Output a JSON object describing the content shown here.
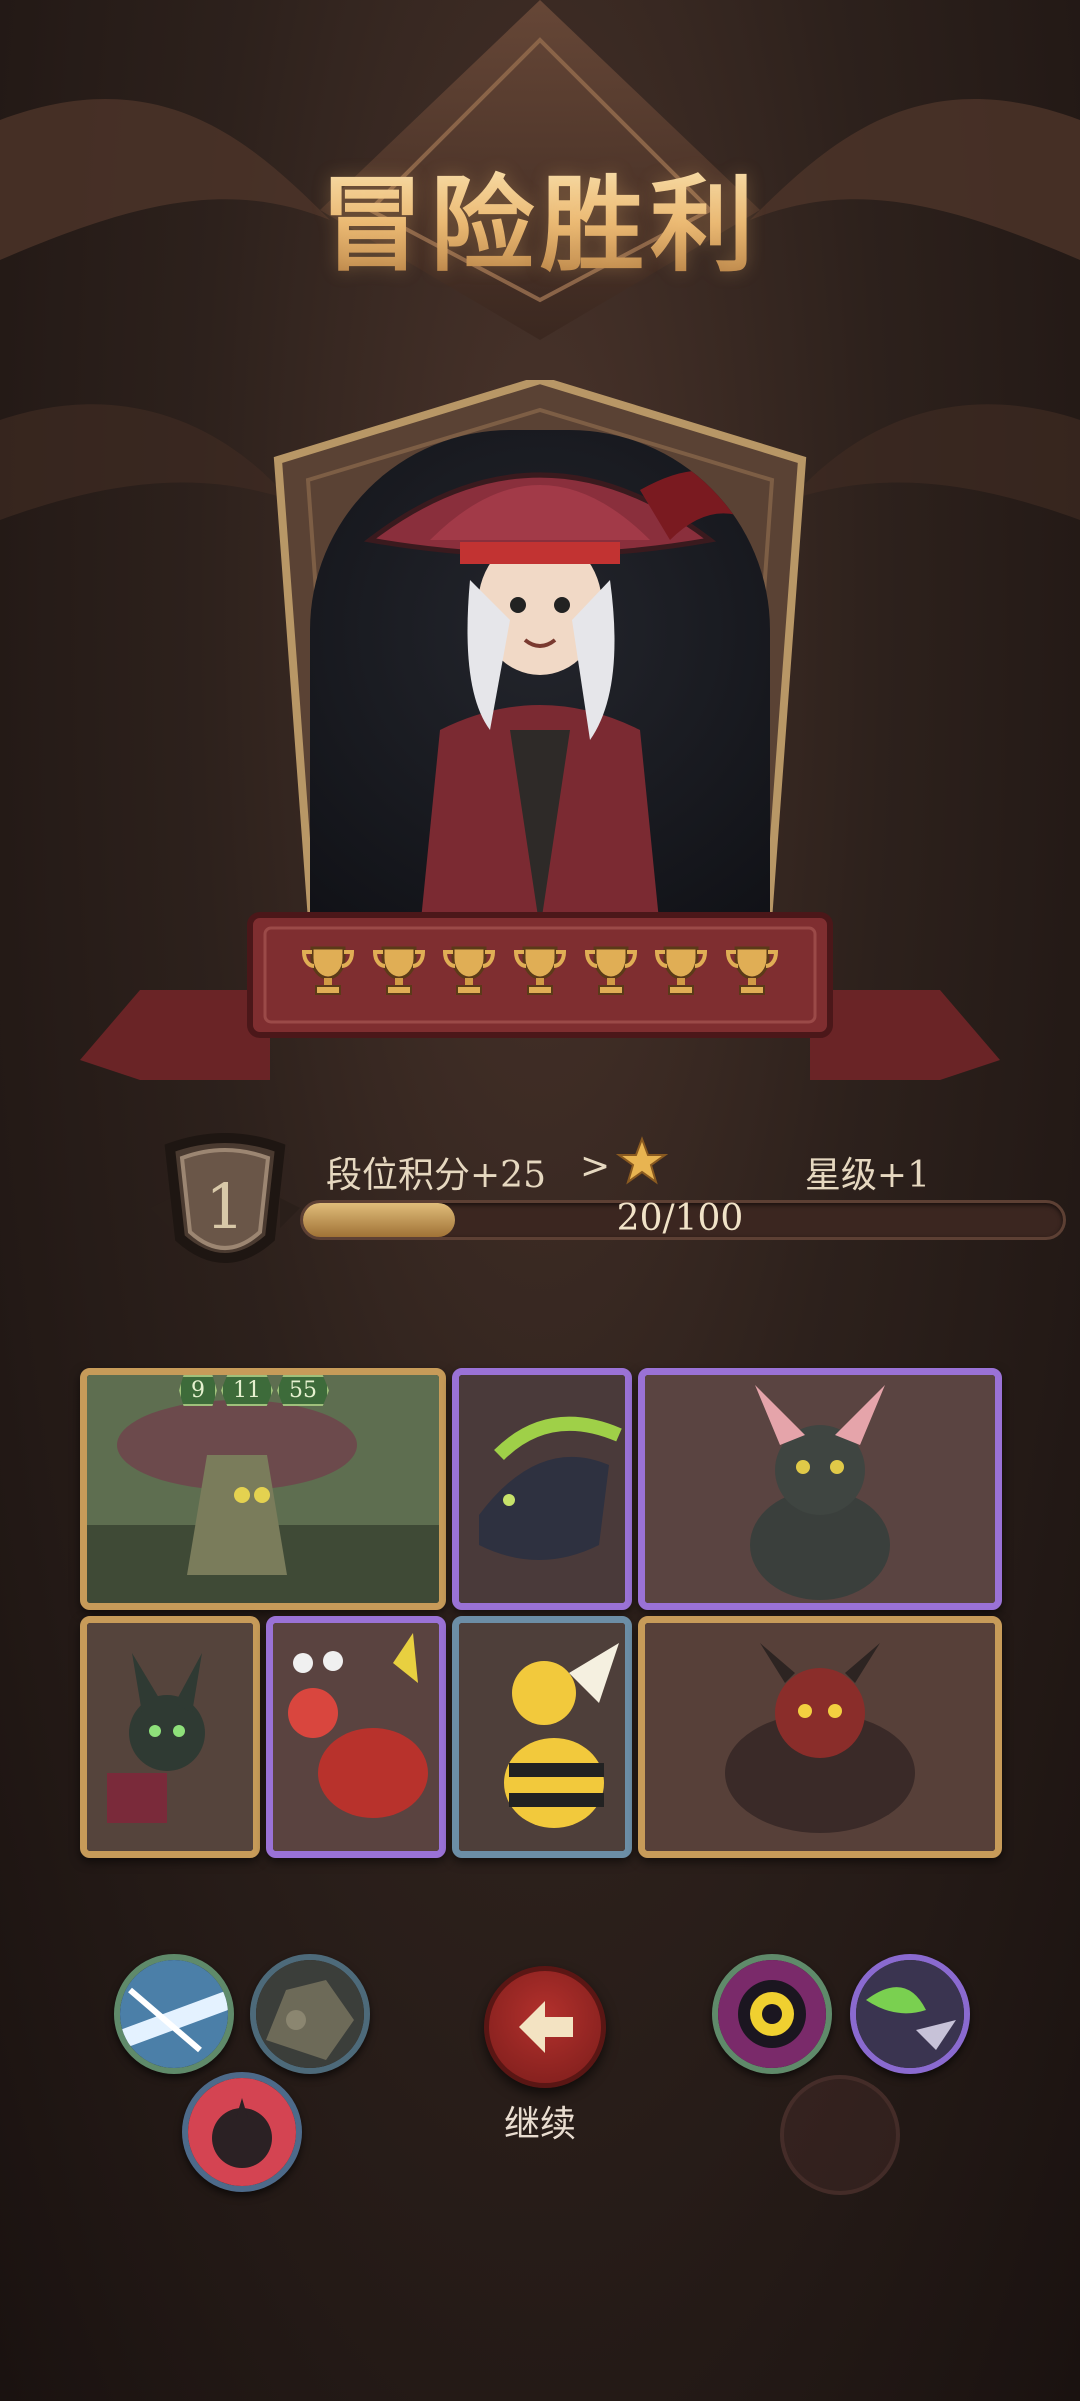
{
  "result": {
    "title": "冒险胜利"
  },
  "trophies": {
    "count": 7,
    "icon": "trophy-icon"
  },
  "rank": {
    "level": "1",
    "points_label": "段位积分+25",
    "arrow": ">",
    "star_icon": "star-icon",
    "star_label": "星级+1",
    "progress_text": "20/100",
    "progress_value": 20,
    "progress_max": 100
  },
  "cards": [
    {
      "name": "mushroom-treant",
      "rarity": "gold",
      "badges": [
        "9",
        "11",
        "55"
      ]
    },
    {
      "name": "shadow-wolf",
      "rarity": "purple"
    },
    {
      "name": "sphinx-cat",
      "rarity": "purple"
    },
    {
      "name": "cat-mage",
      "rarity": "gold"
    },
    {
      "name": "crab-beetle",
      "rarity": "purple"
    },
    {
      "name": "bee",
      "rarity": "blue"
    },
    {
      "name": "demon-beast",
      "rarity": "gold"
    }
  ],
  "skills_left": [
    "ice-slash-icon",
    "rock-icon",
    "shadow-beast-icon"
  ],
  "skills_right": [
    "eye-target-icon",
    "poison-crow-icon"
  ],
  "continue": {
    "label": "继续",
    "icon": "arrow-left-icon"
  },
  "colors": {
    "gold": "#c79b59",
    "purple": "#9a72d6",
    "blue": "#6c8ea6",
    "button_red": "#b3302c"
  }
}
